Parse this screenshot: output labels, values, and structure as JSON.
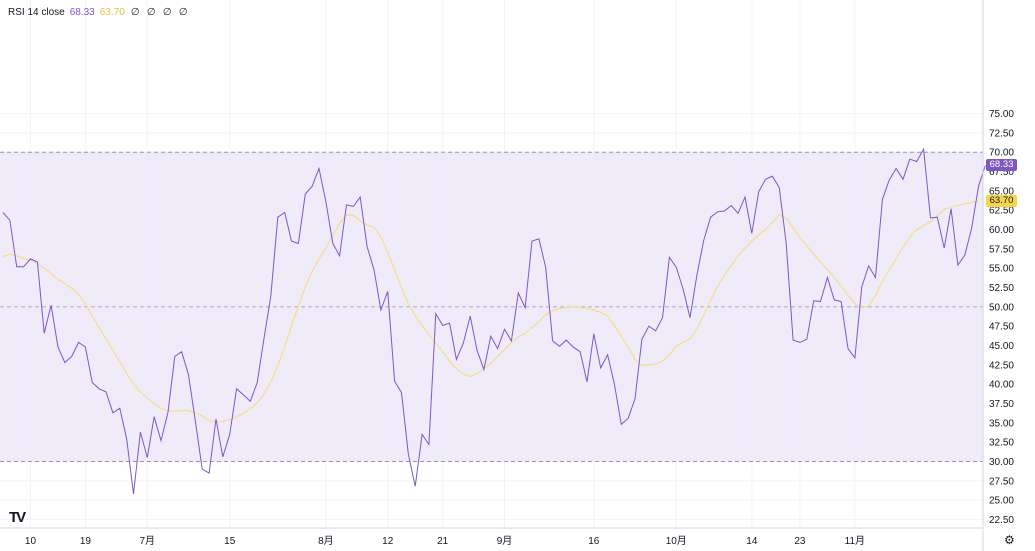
{
  "header": {
    "indicator": "RSI 14 close",
    "rsi_value": "68.33",
    "ma_value": "63.70",
    "null_icons": [
      "∅",
      "∅",
      "∅",
      "∅"
    ]
  },
  "colors": {
    "rsi_line": "#7e57c2",
    "ma_line": "#f5dd8a",
    "band_fill": "#ede7f8",
    "band_border": "#9b8fb4",
    "ma_badge": "#f7d54b",
    "rsi_badge": "#7e57c2"
  },
  "badges": {
    "rsi": "68.33",
    "ma": "63.70"
  },
  "icons": {
    "logo": "tradingview-logo-icon",
    "settings": "gear-icon"
  },
  "chart_data": {
    "type": "line",
    "ylim": [
      21,
      75.5
    ],
    "xlim": [
      0,
      138
    ],
    "y_ticks": [
      "75.00",
      "72.50",
      "70.00",
      "67.50",
      "65.00",
      "62.50",
      "60.00",
      "57.50",
      "55.00",
      "52.50",
      "50.00",
      "47.50",
      "45.00",
      "42.50",
      "40.00",
      "37.50",
      "35.00",
      "32.50",
      "30.00",
      "27.50",
      "25.00",
      "22.50"
    ],
    "x_ticks": [
      {
        "label": "10",
        "x": 4
      },
      {
        "label": "19",
        "x": 12
      },
      {
        "label": "7月",
        "x": 21
      },
      {
        "label": "15",
        "x": 33
      },
      {
        "label": "8月",
        "x": 47
      },
      {
        "label": "12",
        "x": 56
      },
      {
        "label": "21",
        "x": 64
      },
      {
        "label": "9月",
        "x": 73
      },
      {
        "label": "16",
        "x": 86
      },
      {
        "label": "10月",
        "x": 98
      },
      {
        "label": "14",
        "x": 109
      },
      {
        "label": "23",
        "x": 116
      },
      {
        "label": "11月",
        "x": 124
      }
    ],
    "bands": {
      "upper": 70,
      "middle": 50,
      "lower": 30
    },
    "series": [
      {
        "name": "RSI 14 close",
        "values": [
          62.2,
          61.2,
          55.2,
          55.2,
          56.2,
          55.8,
          46.6,
          50.2,
          44.8,
          42.8,
          43.6,
          45.4,
          44.8,
          40.2,
          39.4,
          39.0,
          36.3,
          36.9,
          32.9,
          25.8,
          33.8,
          30.5,
          35.8,
          32.7,
          36.3,
          43.6,
          44.2,
          41.2,
          35.2,
          29.0,
          28.5,
          35.5,
          30.6,
          33.5,
          39.4,
          38.6,
          37.8,
          40.2,
          46.0,
          51.5,
          61.6,
          62.2,
          58.5,
          58.2,
          64.6,
          65.6,
          67.9,
          63.6,
          58.2,
          56.6,
          63.2,
          63.0,
          64.2,
          57.8,
          54.8,
          49.6,
          52.0,
          40.4,
          38.9,
          31.0,
          26.8,
          33.5,
          32.2,
          49.1,
          47.6,
          47.9,
          43.2,
          45.3,
          48.8,
          44.4,
          41.9,
          46.2,
          44.6,
          47.1,
          45.6,
          51.8,
          49.9,
          58.5,
          58.8,
          55.1,
          45.6,
          44.9,
          45.7,
          44.8,
          44.2,
          40.3,
          46.5,
          42.1,
          43.8,
          40.0,
          34.8,
          35.6,
          38.1,
          45.8,
          47.5,
          46.9,
          48.6,
          56.4,
          55.1,
          52.3,
          48.6,
          54.1,
          58.6,
          61.6,
          62.3,
          62.4,
          63.1,
          62.1,
          64.2,
          59.5,
          64.9,
          66.5,
          66.9,
          65.4,
          58.2,
          45.7,
          45.4,
          45.8,
          50.8,
          50.7,
          53.8,
          50.9,
          50.7,
          44.6,
          43.4,
          52.6,
          55.3,
          53.8,
          63.9,
          66.4,
          67.9,
          66.5,
          69.1,
          68.8,
          70.4,
          61.5,
          61.6,
          57.6,
          62.7,
          55.4,
          56.7,
          60.2,
          65.6,
          68.3
        ]
      },
      {
        "name": "MA",
        "values": [
          56.5,
          56.8,
          56.6,
          56.3,
          56.0,
          55.6,
          55.0,
          54.3,
          53.6,
          53.0,
          52.4,
          51.6,
          50.4,
          48.8,
          47.3,
          45.9,
          44.4,
          42.9,
          41.4,
          40.0,
          39.0,
          38.2,
          37.5,
          36.9,
          36.6,
          36.5,
          36.6,
          36.6,
          36.3,
          35.9,
          35.3,
          35.1,
          35.2,
          35.4,
          35.8,
          36.2,
          36.8,
          37.6,
          38.7,
          40.3,
          42.4,
          44.8,
          47.5,
          50.1,
          52.6,
          54.6,
          56.2,
          57.6,
          59.2,
          60.8,
          61.9,
          61.8,
          61.1,
          60.6,
          60.3,
          59.1,
          57.1,
          54.8,
          52.5,
          50.4,
          48.9,
          47.6,
          46.4,
          45.3,
          44.2,
          43.0,
          42.0,
          41.3,
          41.0,
          41.4,
          42.0,
          42.7,
          43.6,
          44.5,
          45.4,
          46.1,
          46.6,
          47.3,
          48.1,
          49.0,
          49.5,
          49.8,
          49.9,
          50.0,
          49.9,
          49.8,
          49.6,
          49.3,
          48.8,
          47.6,
          46.2,
          44.8,
          43.2,
          42.4,
          42.5,
          42.6,
          43.0,
          43.8,
          44.9,
          45.4,
          45.9,
          47.1,
          48.9,
          50.9,
          52.6,
          54.1,
          55.3,
          56.6,
          57.6,
          58.5,
          59.3,
          60.0,
          60.9,
          61.9,
          61.5,
          60.2,
          59.0,
          57.9,
          56.8,
          55.8,
          54.8,
          53.8,
          52.7,
          51.5,
          50.4,
          49.9,
          50.1,
          51.5,
          53.3,
          54.8,
          56.2,
          57.7,
          59.0,
          60.0,
          60.5,
          61.0,
          61.8,
          62.6,
          62.9,
          63.1,
          63.3,
          63.5,
          63.7
        ]
      }
    ]
  }
}
